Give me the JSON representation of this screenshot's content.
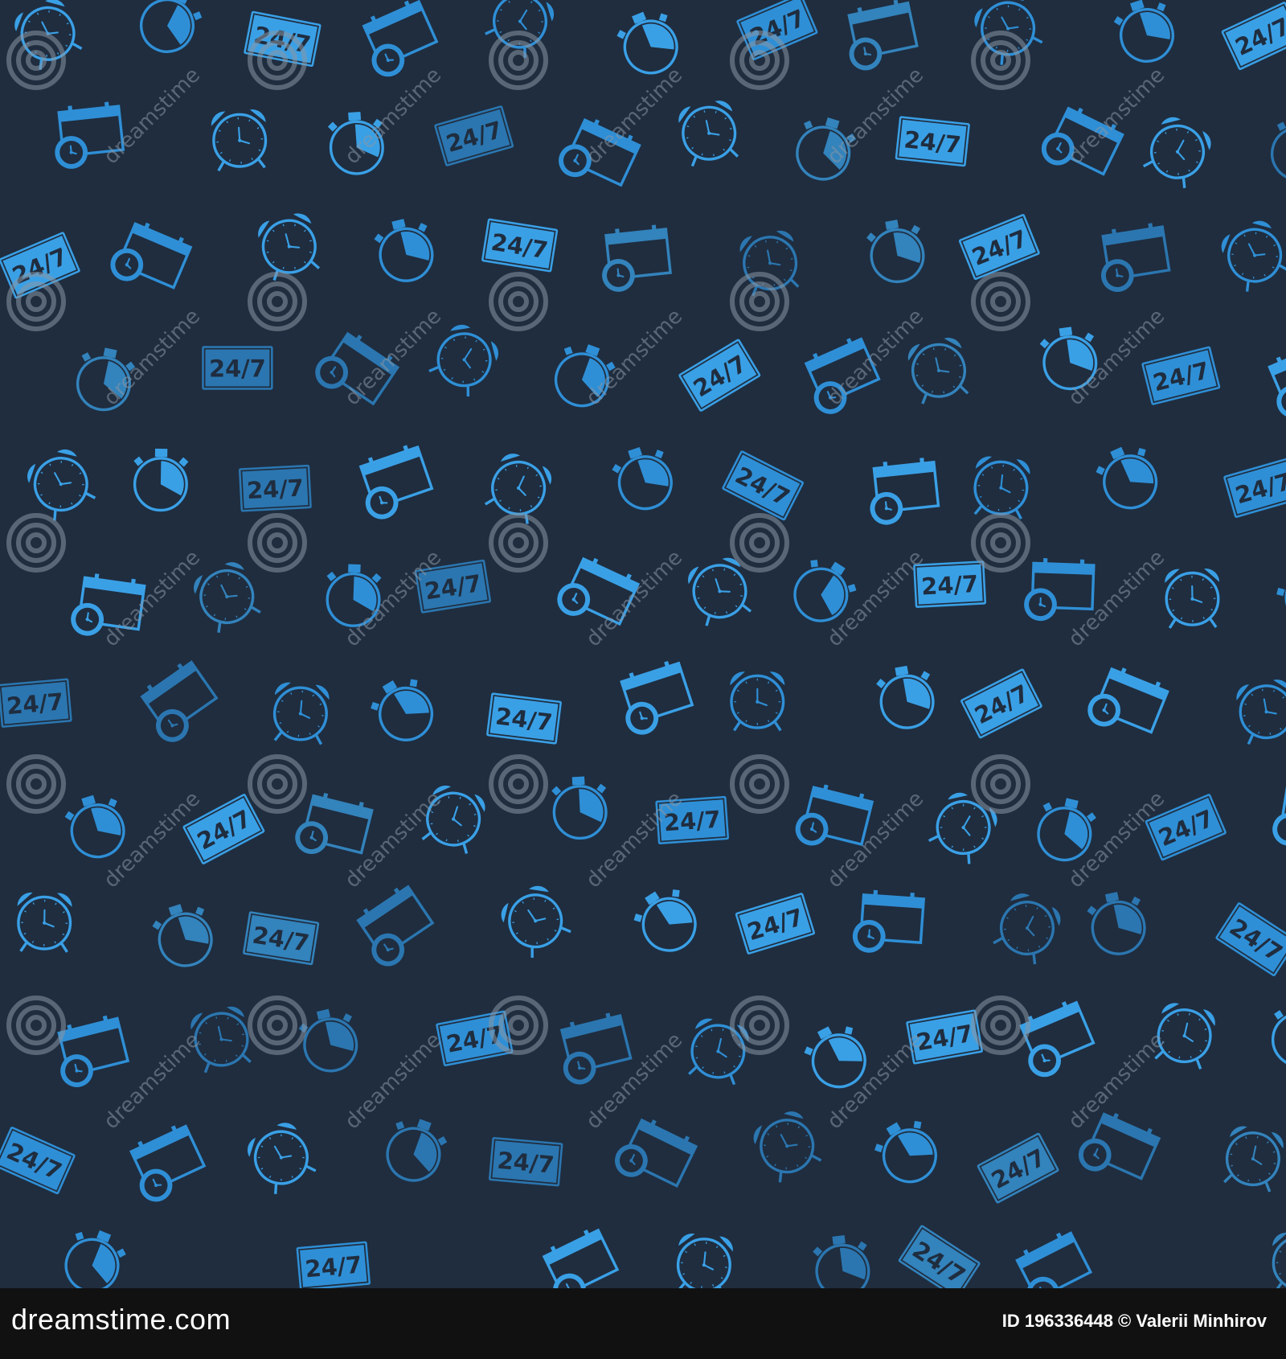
{
  "colors": {
    "background": "#1f2d3f",
    "icon_blue": "#2f8fd6",
    "icon_blue_light": "#3aa0e6",
    "watermark": "#8a96a3",
    "footer_bg": "#111111",
    "footer_text": "#ffffff"
  },
  "pattern": {
    "icon_set": [
      "alarm-clock-icon",
      "stopwatch-icon",
      "24-7-sign-icon",
      "calendar-clock-icon"
    ],
    "sign_text": "24/7"
  },
  "watermark": {
    "brand": "dreamstime",
    "icon": "dreamstime-spiral-icon"
  },
  "footer": {
    "brand": "dreamstime.com",
    "credit": "ID 196336448 © Valerii Minhirov"
  }
}
